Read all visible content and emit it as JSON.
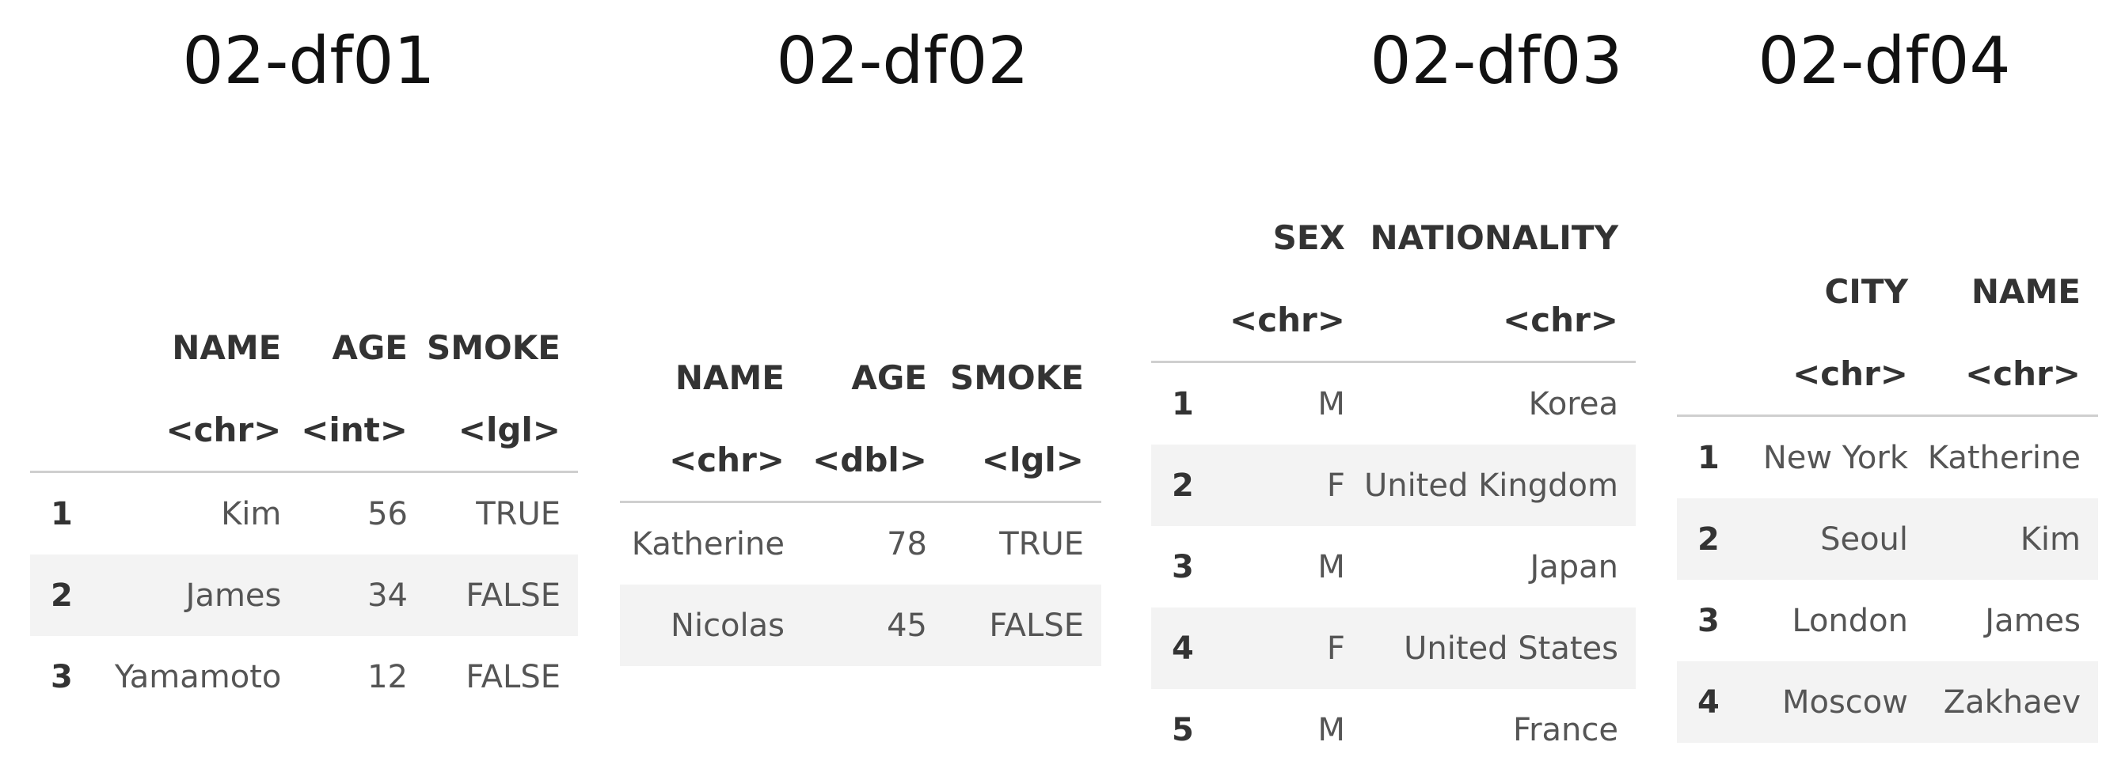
{
  "titles": [
    "02-df01",
    "02-df02",
    "02-df03",
    "02-df04"
  ],
  "df01": {
    "headers": [
      "NAME",
      "AGE",
      "SMOKE"
    ],
    "types": [
      "<chr>",
      "<int>",
      "<lgl>"
    ],
    "rows": [
      {
        "idx": "1",
        "cells": [
          "Kim",
          "56",
          "TRUE"
        ]
      },
      {
        "idx": "2",
        "cells": [
          "James",
          "34",
          "FALSE"
        ]
      },
      {
        "idx": "3",
        "cells": [
          "Yamamoto",
          "12",
          "FALSE"
        ]
      }
    ]
  },
  "df02": {
    "headers": [
      "NAME",
      "AGE",
      "SMOKE"
    ],
    "types": [
      "<chr>",
      "<dbl>",
      "<lgl>"
    ],
    "rows": [
      {
        "cells": [
          "Katherine",
          "78",
          "TRUE"
        ]
      },
      {
        "cells": [
          "Nicolas",
          "45",
          "FALSE"
        ]
      }
    ]
  },
  "df03": {
    "headers": [
      "SEX",
      "NATIONALITY"
    ],
    "types": [
      "<chr>",
      "<chr>"
    ],
    "rows": [
      {
        "idx": "1",
        "cells": [
          "M",
          "Korea"
        ]
      },
      {
        "idx": "2",
        "cells": [
          "F",
          "United Kingdom"
        ]
      },
      {
        "idx": "3",
        "cells": [
          "M",
          "Japan"
        ]
      },
      {
        "idx": "4",
        "cells": [
          "F",
          "United States"
        ]
      },
      {
        "idx": "5",
        "cells": [
          "M",
          "France"
        ]
      }
    ]
  },
  "df04": {
    "headers": [
      "CITY",
      "NAME"
    ],
    "types": [
      "<chr>",
      "<chr>"
    ],
    "rows": [
      {
        "idx": "1",
        "cells": [
          "New York",
          "Katherine"
        ]
      },
      {
        "idx": "2",
        "cells": [
          "Seoul",
          "Kim"
        ]
      },
      {
        "idx": "3",
        "cells": [
          "London",
          "James"
        ]
      },
      {
        "idx": "4",
        "cells": [
          "Moscow",
          "Zakhaev"
        ]
      }
    ]
  }
}
